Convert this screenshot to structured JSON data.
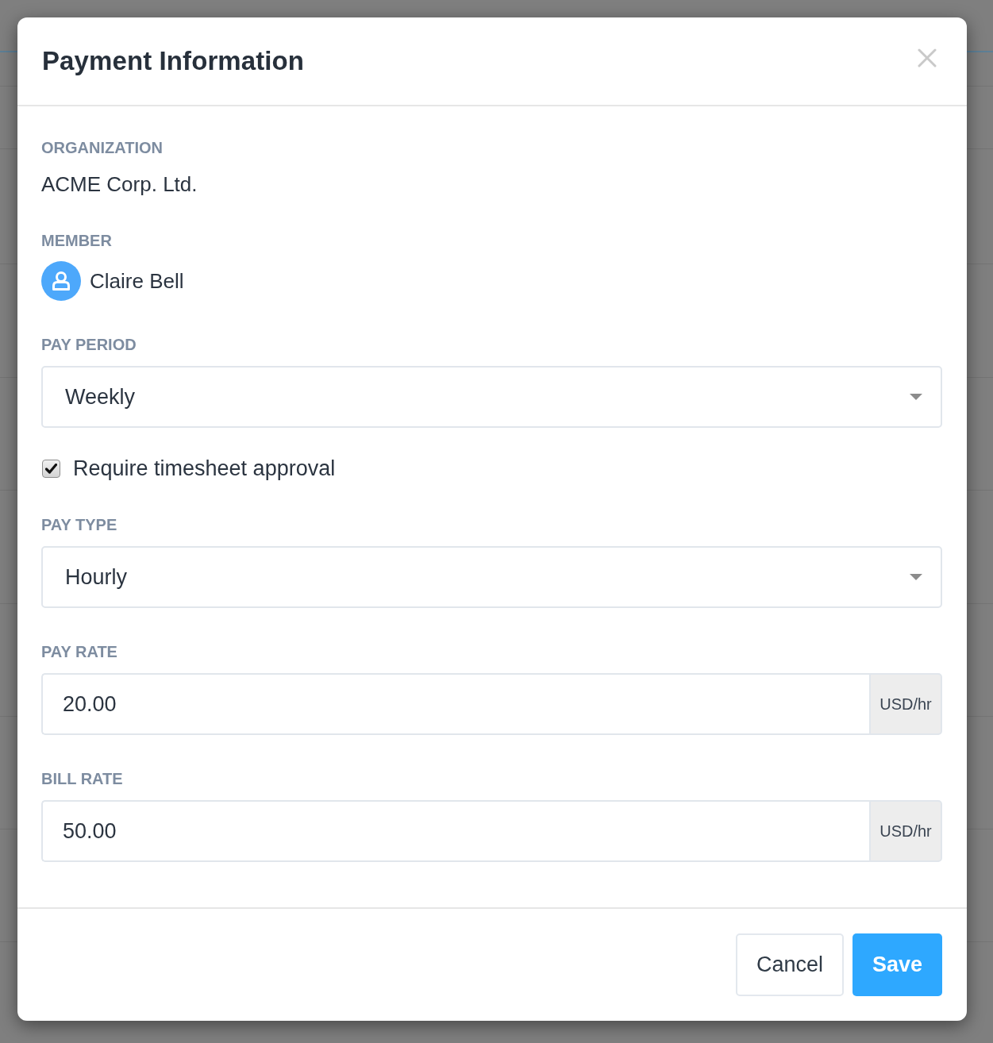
{
  "dialog": {
    "title": "Payment Information"
  },
  "fields": [
    {
      "kind": "text",
      "label": "ORGANIZATION",
      "value": "ACME Corp. Ltd."
    },
    {
      "kind": "member",
      "label": "MEMBER",
      "value": "Claire Bell"
    },
    {
      "kind": "select",
      "label": "PAY PERIOD",
      "value": "Weekly"
    },
    {
      "kind": "checkbox",
      "label": "Require timesheet approval",
      "checked": true
    },
    {
      "kind": "select",
      "label": "PAY TYPE",
      "value": "Hourly"
    },
    {
      "kind": "input",
      "label": "PAY RATE",
      "value": "20.00",
      "unit": "USD/hr"
    },
    {
      "kind": "input",
      "label": "BILL RATE",
      "value": "50.00",
      "unit": "USD/hr"
    }
  ],
  "buttons": [
    {
      "kind": "secondary",
      "label": "Cancel"
    },
    {
      "kind": "primary",
      "label": "Save"
    }
  ]
}
